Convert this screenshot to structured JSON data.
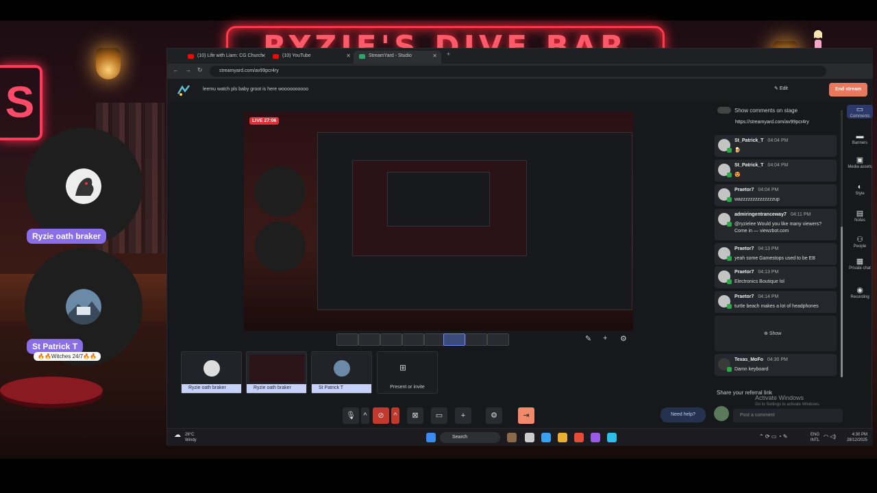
{
  "background": {
    "sign_text": "RYZIE'S DIVE BAR",
    "side_sign": "S"
  },
  "overlay": {
    "guests": [
      {
        "name": "Ryzie oath braker",
        "subtitle": ""
      },
      {
        "name": "St Patrick T",
        "subtitle": "🔥🔥Witches 24/7🔥🔥"
      }
    ]
  },
  "browser": {
    "tabs": [
      {
        "label": "(10) Life with Liam: CG Church",
        "fav_color": "#ff0000",
        "active": false
      },
      {
        "label": "(10) YouTube",
        "fav_color": "#ff0000",
        "active": false
      },
      {
        "label": "StreamYard - Studio",
        "fav_color": "#2ea36b",
        "active": true
      }
    ],
    "url": "streamyard.com/av99pcr4ry"
  },
  "studio": {
    "ticker": "leemu watch pls baby groot is here woooooooooo",
    "edit_label": "Edit",
    "end_stream_label": "End stream",
    "live_badge": "LIVE 27:06",
    "tiles": [
      {
        "name": "Ryzie oath braker"
      },
      {
        "name": "Ryzie oath braker"
      },
      {
        "name": "St Patrick T"
      }
    ],
    "present_label": "Present or invite",
    "need_help_label": "Need help?",
    "post_placeholder": "Post a comment"
  },
  "chat": {
    "show_on_stage_label": "Show comments on stage",
    "top_link": "https://streamyard.com/av99pcr4ry",
    "messages": [
      {
        "user": "St_Patrick_T",
        "time": "04:04 PM",
        "text": "🍺"
      },
      {
        "user": "St_Patrick_T",
        "time": "04:04 PM",
        "text": "😍"
      },
      {
        "user": "Praetor7",
        "time": "04:04 PM",
        "text": "wazzzzzzzzzzzzzzup"
      },
      {
        "user": "admiringentranceway7",
        "time": "04:11 PM",
        "text": "@ryzielee Would you like many viewers? Come in — viewzbot.com"
      },
      {
        "user": "Praetor7",
        "time": "04:13 PM",
        "text": "yeah some Gamestops used to be EB"
      },
      {
        "user": "Praetor7",
        "time": "04:13 PM",
        "text": "Electronics Boutique lol"
      },
      {
        "user": "Praetor7",
        "time": "04:14 PM",
        "text": "turtle beach makes a lot of headphones"
      },
      {
        "user": "Texas_MoFo",
        "time": "04:30 PM",
        "text": "Damn keyboard"
      }
    ],
    "hidden_label": "Show",
    "referral_label": "Share your referral link",
    "activate_title": "Activate Windows",
    "activate_sub": "Go to Settings to activate Windows."
  },
  "rail": [
    {
      "label": "Comments",
      "icon": "chat-icon"
    },
    {
      "label": "Banners",
      "icon": "banner-icon"
    },
    {
      "label": "Media assets",
      "icon": "media-icon"
    },
    {
      "label": "Style",
      "icon": "palette-icon"
    },
    {
      "label": "Notes",
      "icon": "notes-icon"
    },
    {
      "label": "People",
      "icon": "people-icon"
    },
    {
      "label": "Private chat",
      "icon": "private-chat-icon"
    },
    {
      "label": "Recording",
      "icon": "record-icon"
    }
  ],
  "taskbar": {
    "weather_temp": "28°C",
    "weather_desc": "Windy",
    "search_label": "Search",
    "lang_top": "ENG",
    "lang_bottom": "INTL",
    "time": "4:30 PM",
    "date": "28/12/2025"
  },
  "colors": {
    "accent": "#8a6ee8",
    "end_stream": "#e8795e",
    "live": "#e0303a",
    "neon": "#ff3a4a"
  }
}
